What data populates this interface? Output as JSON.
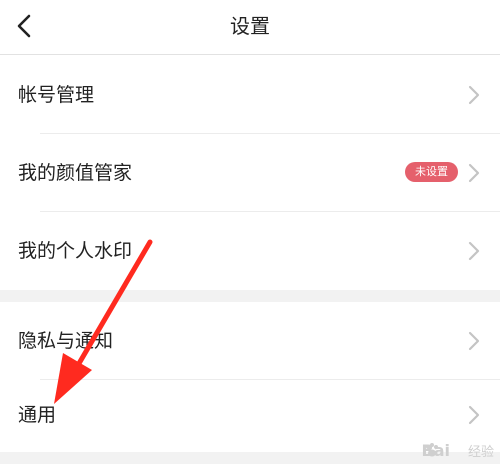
{
  "header": {
    "title": "设置"
  },
  "group1": [
    {
      "label": "帐号管理"
    },
    {
      "label": "我的颜值管家",
      "badge": "未设置"
    },
    {
      "label": "我的个人水印"
    }
  ],
  "group2": [
    {
      "label": "隐私与通知"
    },
    {
      "label": "通用"
    }
  ],
  "watermark": {
    "brand": "Bai",
    "suffix": "经验"
  },
  "colors": {
    "badge_bg": "#e5606c",
    "arrow": "#ff2a1f",
    "chevron": "#c4c4c4",
    "section_gap": "#f2f2f2"
  }
}
